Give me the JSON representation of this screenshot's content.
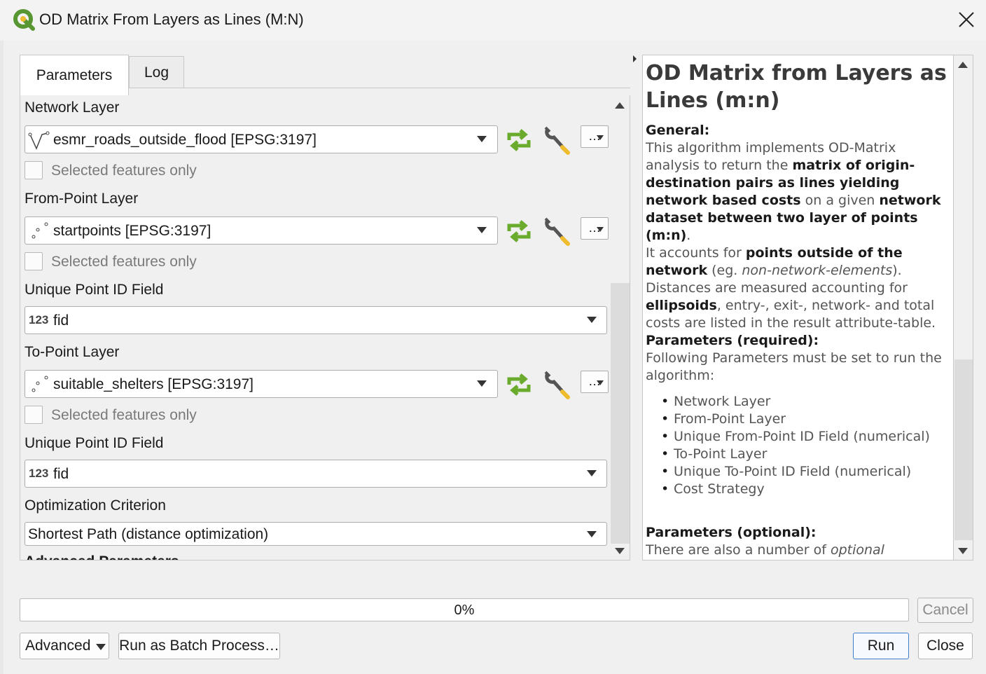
{
  "window": {
    "title": "OD Matrix From Layers as Lines (M:N)"
  },
  "tabs": [
    {
      "label": "Parameters",
      "active": true
    },
    {
      "label": "Log",
      "active": false
    }
  ],
  "params": {
    "network_layer": {
      "label": "Network Layer",
      "value": "esmr_roads_outside_flood [EPSG:3197]",
      "selected_only_label": "Selected features only"
    },
    "from_point_layer": {
      "label": "From-Point Layer",
      "value": "startpoints [EPSG:3197]",
      "selected_only_label": "Selected features only"
    },
    "from_id_field": {
      "label": "Unique Point ID Field",
      "type_badge": "123",
      "value": "fid"
    },
    "to_point_layer": {
      "label": "To-Point Layer",
      "value": "suitable_shelters [EPSG:3197]",
      "selected_only_label": "Selected features only"
    },
    "to_id_field": {
      "label": "Unique Point ID Field",
      "type_badge": "123",
      "value": "fid"
    },
    "optimization": {
      "label": "Optimization Criterion",
      "value": "Shortest Path (distance optimization)"
    },
    "advanced_partial": "Advanced Parameters",
    "dots_label": "…"
  },
  "help": {
    "heading": "OD Matrix from Layers as Lines (m:n)",
    "general_title": "General:",
    "general_p1_a": "This algorithm implements OD-Matrix analysis to return the ",
    "general_p1_b": "matrix of origin-destination pairs as lines yielding network based costs",
    "general_p1_c": " on a given ",
    "general_p1_d": "network dataset between two layer of points (m:n)",
    "general_p1_e": ".",
    "general_p2_a": "It accounts for ",
    "general_p2_b": "points outside of the network",
    "general_p2_c": " (eg. ",
    "general_p2_d": "non-network-elements",
    "general_p2_e": ").",
    "general_p3_a": "Distances are measured accounting for ",
    "general_p3_b": "ellipsoids",
    "general_p3_c": ", entry-, exit-, network- and total costs are listed in the result attribute-table.",
    "required_title": "Parameters (required):",
    "required_text": "Following Parameters must be set to run the algorithm:",
    "required_items": [
      "Network Layer",
      "From-Point Layer",
      "Unique From-Point ID Field (numerical)",
      "To-Point Layer",
      "Unique To-Point ID Field (numerical)",
      "Cost Strategy"
    ],
    "optional_title": "Parameters (optional):",
    "optional_text_a": "There are also a number of ",
    "optional_text_b": "optional"
  },
  "progress": {
    "value": 0,
    "text": "0%"
  },
  "buttons": {
    "cancel": "Cancel",
    "advanced": "Advanced",
    "batch": "Run as Batch Process…",
    "run": "Run",
    "close": "Close"
  },
  "colors": {
    "qgis_green": "#589632",
    "qgis_yellow": "#eebc2d",
    "refresh_green": "#6aab2e",
    "run_border": "#3c7fd0"
  },
  "icons": {
    "app": "qgis-logo-icon",
    "close": "close-icon",
    "line_layer": "line-layer-icon",
    "point_layer": "point-layer-icon",
    "refresh": "iterate-icon",
    "settings": "wrench-icon"
  }
}
